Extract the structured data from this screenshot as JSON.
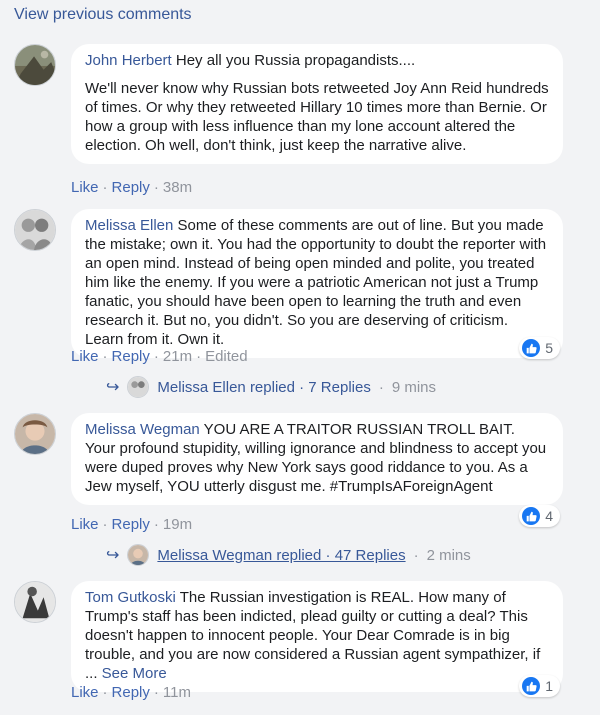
{
  "view_previous": "View previous comments",
  "sep": "·",
  "colors": {
    "link": "#385898",
    "action_link": "#4267b2",
    "muted": "#90949c",
    "like_blue": "#1877f2",
    "bg": "#f2f3f5"
  },
  "comments": [
    {
      "author": "John Herbert",
      "first_line": " Hey all you Russia propagandists....",
      "body": "We'll never know why Russian bots retweeted Joy Ann Reid hundreds of times. Or why they retweeted Hillary 10 times more than Bernie. Or how a group with less influence than my lone account altered the election. Oh well, don't think, just keep the narrative alive.",
      "like": "Like",
      "reply": "Reply",
      "time": "38m"
    },
    {
      "author": "Melissa Ellen",
      "body": " Some of these comments are out of line. But you made the mistake; own it. You had the opportunity to doubt the reporter with an open mind. Instead of being open minded and polite, you treated him like the enemy. If you were a patriotic American not just a Trump fanatic, you should have been open to learning the truth and even research it. But no, you didn't. So you are deserving of criticism. Learn from it. Own it.",
      "like": "Like",
      "reply": "Reply",
      "time": "21m",
      "edited": "Edited",
      "reactions": "5",
      "replied_text": "Melissa Ellen replied · 7 Replies",
      "replied_time": "9 mins"
    },
    {
      "author": "Melissa Wegman",
      "body": " YOU ARE A TRAITOR RUSSIAN TROLL BAIT. Your profound stupidity, willing ignorance and blindness to accept you were duped proves why New York says good riddance to you. As a Jew myself, YOU utterly disgust me. #TrumpIsAForeignAgent",
      "like": "Like",
      "reply": "Reply",
      "time": "19m",
      "reactions": "4",
      "replied_text": "Melissa Wegman replied · 47 Replies",
      "replied_time": "2 mins"
    },
    {
      "author": "Tom Gutkoski",
      "body": " The Russian investigation is REAL. How many of Trump's staff has been indicted, plead guilty or cutting a deal? This doesn't happen to innocent people. Your Dear Comrade is in big trouble, and you are now considered a Russian agent sympathizer, if ... ",
      "see_more": "See More",
      "like": "Like",
      "reply": "Reply",
      "time": "11m",
      "reactions": "1"
    }
  ]
}
